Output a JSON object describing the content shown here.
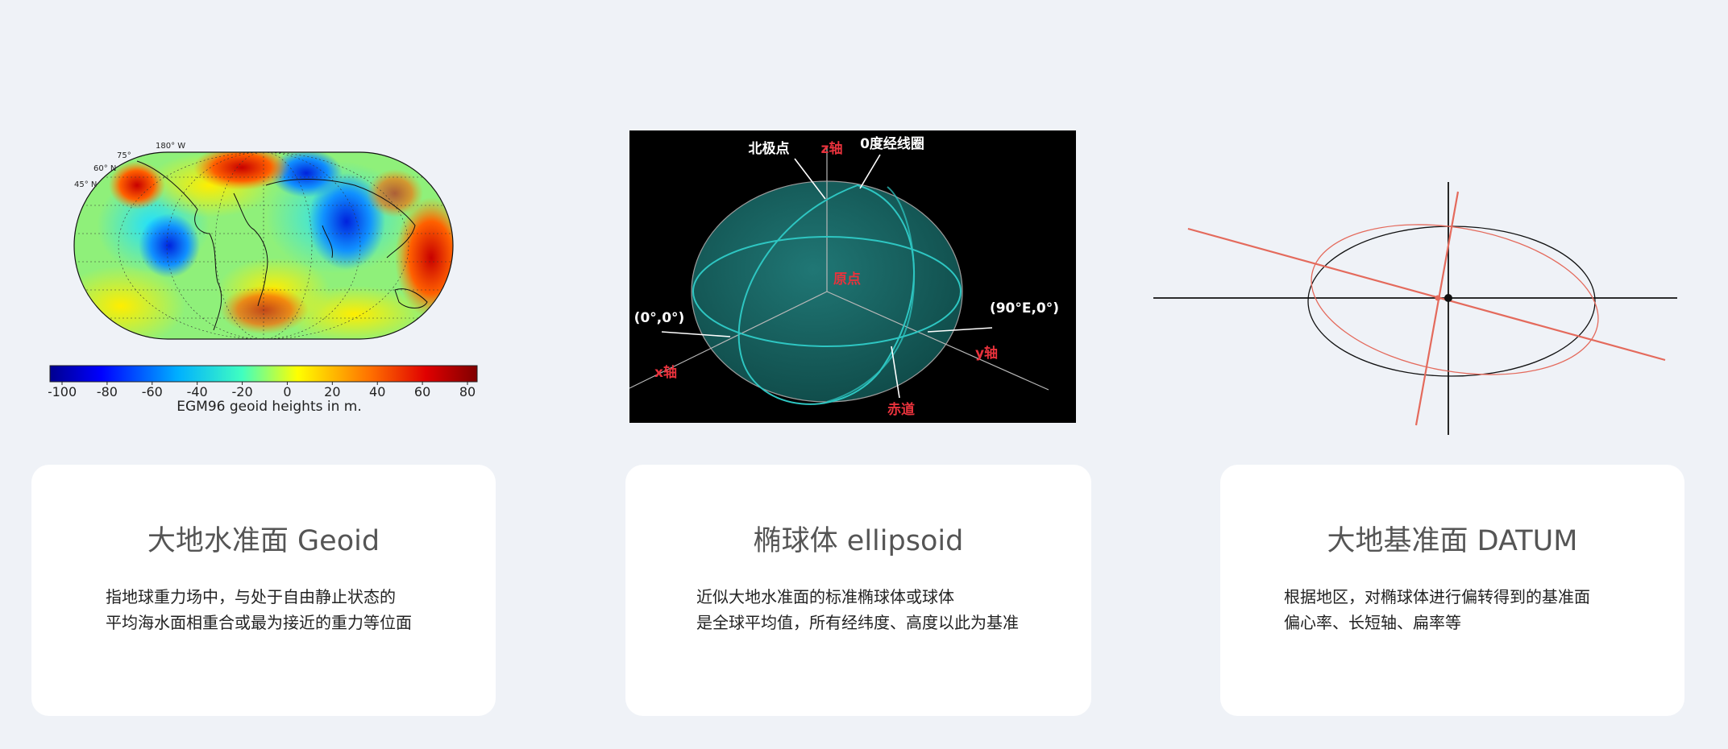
{
  "geoid_figure": {
    "graticule_labels": [
      "180° W",
      "75°",
      "60° N",
      "45° N"
    ],
    "colorbar_ticks": [
      "-100",
      "-80",
      "-60",
      "-40",
      "-20",
      "0",
      "20",
      "40",
      "60",
      "80"
    ],
    "caption": "EGM96 geoid heights in m."
  },
  "ellipsoid_figure": {
    "labels": {
      "north_pole": "北极点",
      "z_axis": "z轴",
      "prime_meridian": "0度经线圈",
      "origin": "原点",
      "point_0_0": "(0°,0°)",
      "point_90e_0": "(90°E,0°)",
      "x_axis": "x轴",
      "y_axis": "y轴",
      "equator": "赤道"
    },
    "colors": {
      "label_red": "#e8323c",
      "label_white": "#ffffff",
      "ellipsoid_fill": "#1d6b68",
      "curve": "#2ec6c2"
    }
  },
  "datum_figure": {
    "colors": {
      "reference": "#111111",
      "shifted": "#e46a5c"
    }
  },
  "cards": [
    {
      "title": "大地水准面 Geoid",
      "lines": [
        "指地球重力场中，与处于自由静止状态的",
        "平均海水面相重合或最为接近的重力等位面"
      ]
    },
    {
      "title": "椭球体 ellipsoid",
      "lines": [
        "近似大地水准面的标准椭球体或球体",
        "是全球平均值，所有经纬度、高度以此为基准"
      ]
    },
    {
      "title": "大地基准面 DATUM",
      "lines": [
        "根据地区，对椭球体进行偏转得到的基准面",
        "偏心率、长短轴、扁率等"
      ]
    }
  ]
}
